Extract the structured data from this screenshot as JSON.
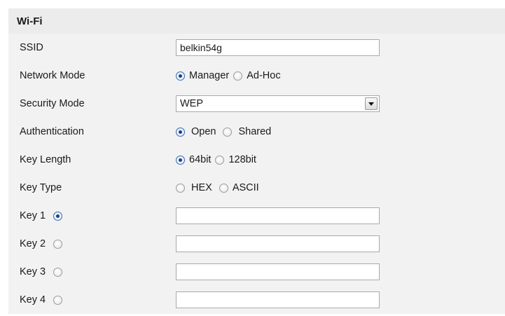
{
  "header": {
    "title": "Wi-Fi"
  },
  "ssid": {
    "label": "SSID",
    "value": "belkin54g"
  },
  "network_mode": {
    "label": "Network Mode",
    "options": [
      {
        "label": "Manager",
        "checked": true
      },
      {
        "label": "Ad-Hoc",
        "checked": false
      }
    ]
  },
  "security_mode": {
    "label": "Security Mode",
    "selected": "WEP"
  },
  "authentication": {
    "label": "Authentication",
    "options": [
      {
        "label": "Open",
        "checked": true
      },
      {
        "label": "Shared",
        "checked": false
      }
    ]
  },
  "key_length": {
    "label": "Key Length",
    "options": [
      {
        "label": "64bit",
        "checked": true
      },
      {
        "label": "128bit",
        "checked": false
      }
    ]
  },
  "key_type": {
    "label": "Key Type",
    "options": [
      {
        "label": "HEX",
        "checked": false
      },
      {
        "label": "ASCII",
        "checked": false
      }
    ]
  },
  "keys": [
    {
      "label": "Key 1",
      "selected": true,
      "value": ""
    },
    {
      "label": "Key 2",
      "selected": false,
      "value": ""
    },
    {
      "label": "Key 3",
      "selected": false,
      "value": ""
    },
    {
      "label": "Key 4",
      "selected": false,
      "value": ""
    }
  ]
}
